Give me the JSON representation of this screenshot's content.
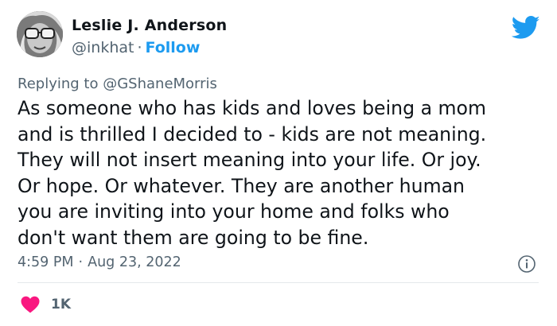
{
  "author": {
    "display_name": "Leslie J. Anderson",
    "handle": "@inkhat",
    "separator": "·",
    "follow_label": "Follow"
  },
  "reply": {
    "prefix": "Replying to",
    "handle": "@GShaneMorris"
  },
  "tweet": {
    "text_lines": [
      "As someone who has kids and loves being a mom",
      "and is thrilled I decided to - kids are not meaning.",
      "They will not insert meaning into your life. Or joy.",
      "Or hope. Or whatever. They are another human",
      "you are inviting into your home and folks who",
      "don't want them are going to be fine."
    ]
  },
  "meta": {
    "time": "4:59 PM",
    "separator": "·",
    "date": "Aug 23, 2022"
  },
  "actions": {
    "like_count": "1K"
  },
  "icons": {
    "brand": "twitter-bird-icon",
    "info": "info-icon",
    "like": "heart-icon"
  },
  "colors": {
    "brand_blue": "#1d9bf0",
    "text_primary": "#0f1419",
    "text_secondary": "#536471",
    "like_pink": "#f91880",
    "divider": "#e4e8eb"
  }
}
